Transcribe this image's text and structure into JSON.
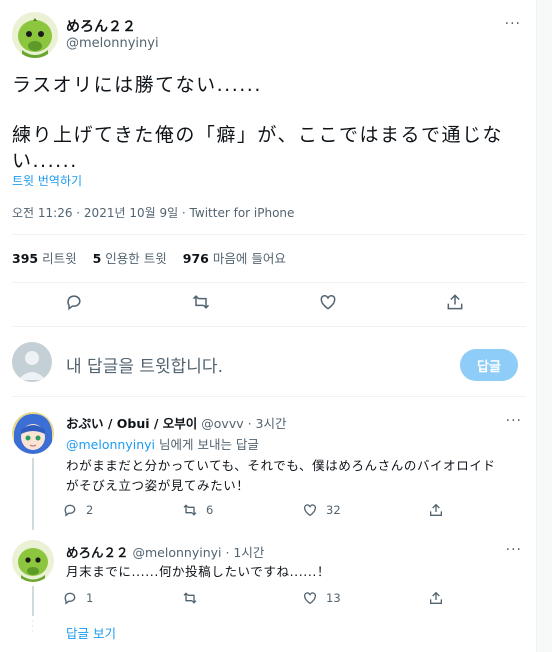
{
  "tweet": {
    "author_name": "めろん２２",
    "author_handle": "@melonnyinyi",
    "more": "···",
    "line1": "ラスオリには勝てない......",
    "line2": "練り上げてきた俺の「癖」が、ここではまるで通じな",
    "line3": "い......",
    "translate": "트윗 번역하기",
    "meta": "오전 11:26 · 2021년 10월 9일 · Twitter for iPhone",
    "stats": {
      "retweets_count": "395",
      "retweets_label": "리트윗",
      "quotes_count": "5",
      "quotes_label": "인용한 트윗",
      "likes_count": "976",
      "likes_label": "마음에 들어요"
    },
    "action_icons": [
      "reply-icon",
      "retweet-icon",
      "like-icon",
      "share-icon"
    ]
  },
  "reply_box": {
    "placeholder": "내 답글을 트윗합니다.",
    "button": "답글"
  },
  "replies": [
    {
      "name": "おぷい / Obui / 오부이",
      "handle": "@ovvv",
      "time": "· 3시간",
      "to_mention": "@melonnyinyi",
      "to_suffix": "님에게 보내는 답글",
      "text1": "わがままだと分かっていても、それでも、僕はめろんさんのバイオロイド",
      "text2": "がそびえ立つ姿が見てみたい！",
      "reply_count": "2",
      "retweet_count": "6",
      "like_count": "32"
    },
    {
      "name": "めろん２２",
      "handle": "@melonnyinyi",
      "time": "· 1시간",
      "text1": "月末までに......何か投稿したいですね......！",
      "reply_count": "1",
      "retweet_count": "",
      "like_count": "13"
    }
  ],
  "show_more": "답글 보기",
  "colors": {
    "accent": "#1d9bf0",
    "muted": "#536471",
    "button_disabled": "#8ecdf8"
  }
}
